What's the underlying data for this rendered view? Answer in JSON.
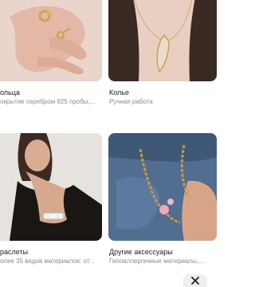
{
  "categories": [
    {
      "title": "ольца",
      "subtitle": "окрытие серебром 925 пробы,...",
      "icon": "rings-hand-image"
    },
    {
      "title": "Колье",
      "subtitle": "Ручная работа",
      "icon": "leaf-necklace-image"
    },
    {
      "title": "раслеты",
      "subtitle": "олее 35 видов материалов: от...",
      "icon": "bracelet-hand-image"
    },
    {
      "title": "Другие аксессуары",
      "subtitle": "Гипоаллергенные материалы,...",
      "icon": "jeans-chain-image"
    }
  ],
  "close_icon": "close-icon"
}
